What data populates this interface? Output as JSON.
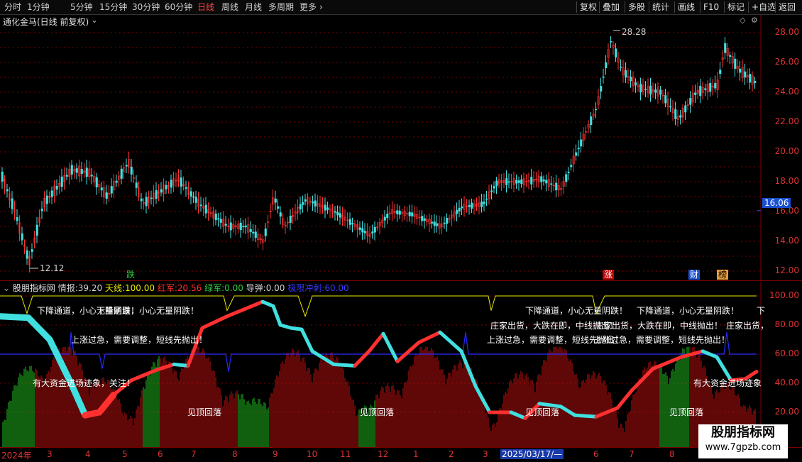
{
  "toolbar": {
    "periods": [
      "分时",
      "1分钟",
      "5分钟",
      "15分钟",
      "30分钟",
      "60分钟",
      "日线",
      "周线",
      "月线",
      "多周期",
      "更多"
    ],
    "active_period": "日线",
    "more_chevron": "›",
    "actions": [
      "复权",
      "叠加",
      "多股",
      "统计",
      "画线",
      "F10",
      "标记",
      "+自选",
      "返回"
    ]
  },
  "main": {
    "title": "通化金马(日线 前复权)",
    "title_chevron": "⌄",
    "y_ticks": [
      "28.00",
      "26.00",
      "24.00",
      "22.00",
      "20.00",
      "18.00",
      "16.00",
      "14.00",
      "12.00"
    ],
    "price_now": "16.06",
    "high_label": "28.28",
    "low_label": "12.12",
    "signal_tags": [
      {
        "text": "跌",
        "color": "#2ecc40"
      },
      {
        "text": "涨",
        "color": "#ff3030"
      },
      {
        "text": "财",
        "color": "#3a7bff"
      },
      {
        "text": "榜",
        "color": "#e89b3a"
      }
    ]
  },
  "indicator": {
    "name": "股朋指标网",
    "items": [
      {
        "label": "情报:",
        "value": "39.20",
        "color": "#d0d0d0"
      },
      {
        "label": "天线:",
        "value": "100.00",
        "color": "#e8e800"
      },
      {
        "label": "红军:",
        "value": "20.56",
        "color": "#ff3030"
      },
      {
        "label": "绿军:",
        "value": "0.00",
        "color": "#2ecc40"
      },
      {
        "label": "导弹:",
        "value": "0.00",
        "color": "#d0d0d0"
      },
      {
        "label": "极限冲刺:",
        "value": "60.00",
        "color": "#3a3aff"
      }
    ],
    "y_ticks": [
      "100.00",
      "80.00",
      "60.00",
      "40.00",
      "20.00"
    ],
    "annotations": [
      "下降通道，小心无量阴跌！",
      "下降通道，小心无量阴跌！",
      "下降通道，小心无量阴跌！",
      "下降通道，小心无量阴跌！",
      "下",
      "上涨过急，需要调整，短线先抛出！",
      "上涨过急，需要调整，短线先抛出！",
      "上涨过急，需要调整，短线先抛出！",
      "庄家出货，大跌在即，中线抛出！",
      "庄家出货，大跌在即，中线抛出！",
      "庄家出货，",
      "有大资金进场迹象，关注！",
      "有大资金进场迹象",
      "见顶回落",
      "见顶回落",
      "见顶回落",
      "见顶回落"
    ]
  },
  "date_axis": {
    "labels": [
      "2024年",
      "3",
      "4",
      "5",
      "6",
      "7",
      "8",
      "9",
      "10",
      "11",
      "12",
      "1",
      "2",
      "3",
      "6",
      "7",
      "8"
    ],
    "cursor": "2025/03/17/—"
  },
  "watermark": {
    "title": "股朋指标网",
    "url": "www.7gpzb.com"
  },
  "colors": {
    "up": "#ff3030",
    "down": "#40e0e0",
    "grid": "#7a0000",
    "axis_text": "#d33333"
  }
}
